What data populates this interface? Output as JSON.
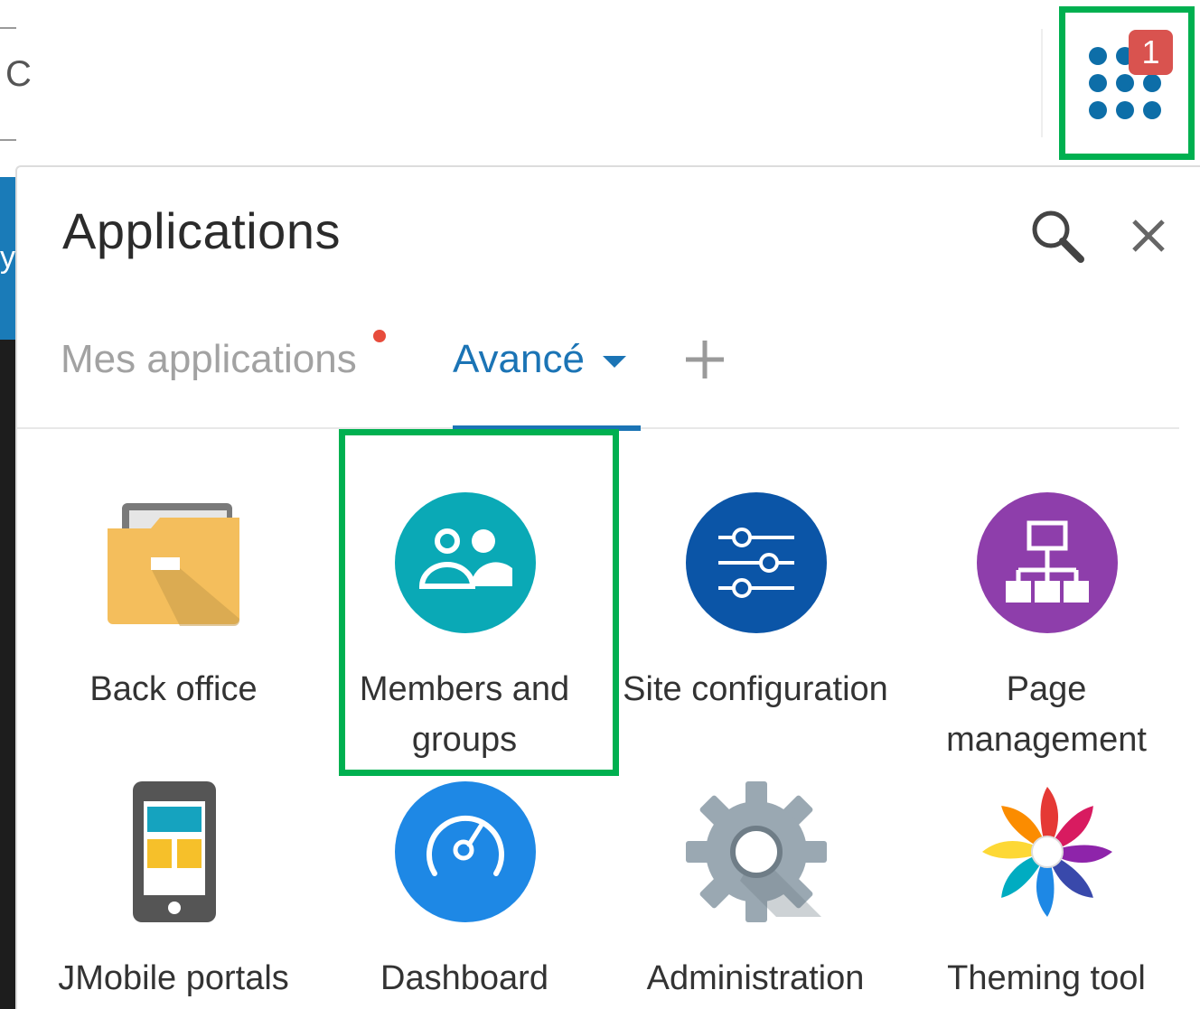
{
  "launcher": {
    "badge_count": "1",
    "icon": "apps-grid-icon",
    "accent_color": "#0d6ea8",
    "badge_color": "#d9534f"
  },
  "background": {
    "partial_glyph": "C",
    "strip_glyph": "y"
  },
  "panel": {
    "title": "Applications",
    "search_icon": "search-icon",
    "close_icon": "close-icon"
  },
  "tabs": {
    "mine": {
      "label": "Mes applications",
      "has_notification": true
    },
    "advanced": {
      "label": "Avancé",
      "active": true
    },
    "add_icon": "plus-icon"
  },
  "apps": [
    {
      "label": "Back office",
      "icon": "folder-icon"
    },
    {
      "label": "Members and groups",
      "icon": "users-icon",
      "color": "#0aa9b6"
    },
    {
      "label": "Site configuration",
      "icon": "sliders-icon",
      "color": "#0b55a7"
    },
    {
      "label": "Page management",
      "icon": "sitemap-icon",
      "color": "#8e3eab"
    },
    {
      "label": "JMobile portals",
      "icon": "mobile-icon"
    },
    {
      "label": "Dashboard",
      "icon": "speedometer-icon",
      "color": "#1e88e5"
    },
    {
      "label": "Administration",
      "icon": "gear-icon"
    },
    {
      "label": "Theming tool",
      "icon": "pinwheel-icon"
    }
  ],
  "highlight_color": "#00b050"
}
